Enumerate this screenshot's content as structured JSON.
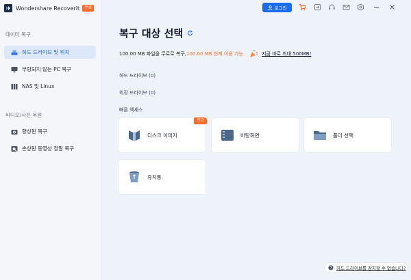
{
  "app": {
    "name": "Wondershare Recoverit",
    "badge": "무료"
  },
  "sidebar": {
    "section1": "데이터 복구",
    "items1": [
      {
        "label": "하드 드라이브 및 위치"
      },
      {
        "label": "부팅되지 않는 PC 복구"
      },
      {
        "label": "NAS 및 Linux"
      }
    ],
    "section2": "비디오/사진 복원",
    "items2": [
      {
        "label": "향상된 복구"
      },
      {
        "label": "손상된 동영상 정말 복구"
      }
    ]
  },
  "titlebar": {
    "login_label": "로그인"
  },
  "main": {
    "title": "복구 대상 선택",
    "promo_prefix": "100.00 MB 파일을 무료로 복구, ",
    "promo_highlight": "100.00 MB 현재 이용 가능.",
    "promo_link": "지금 바로 최대 500MB!",
    "hard_drive_label": "하드 드라이브 (0)",
    "external_drive_label": "외장 드라이브 (0)",
    "quick_access_label": "빠른 엑세스",
    "cards": [
      {
        "label": "디스크 이미지",
        "badge": "신규"
      },
      {
        "label": "바탕화면"
      },
      {
        "label": "폴더 선택"
      },
      {
        "label": "휴지통"
      }
    ],
    "help_text": "하드 드라이브를 감지할 수 없습니다?"
  },
  "colors": {
    "accent": "#1a6cf0",
    "orange": "#ff6a2b",
    "active_bg": "#dde9fb"
  }
}
